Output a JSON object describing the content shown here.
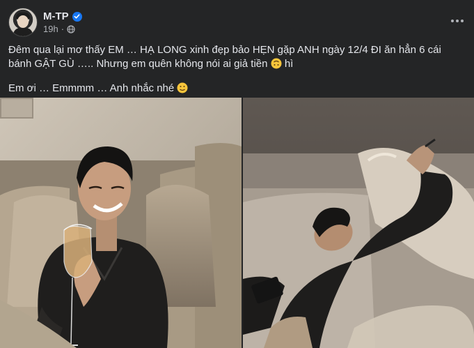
{
  "post": {
    "author": "M-TP",
    "verified": true,
    "time": "19h",
    "audience_icon": "globe-icon",
    "more_icon": "more-horizontal-icon",
    "text_line1": "Đêm qua lại mơ thấy EM … HẠ LONG xinh đẹp bảo HẸN gặp ANH ngày 12/4 ĐI ăn hẳn 6 cái bánh GẬT GÙ ….. Nhưng em quên không nói ai giả tiền",
    "text_line1_end": "hì",
    "text_line2": "Em ơi … Emmmm … Anh nhắc nhé",
    "emoji1": "upside-down-face-emoji",
    "emoji2": "slightly-smiling-face-emoji"
  },
  "photos": [
    {
      "name": "photo-man-with-wine-glass"
    },
    {
      "name": "photo-man-lying-on-sofa"
    }
  ],
  "colors": {
    "background": "#242526",
    "text": "#e4e6eb",
    "secondary_text": "#b0b3b8",
    "verified_blue": "#1877f2"
  }
}
